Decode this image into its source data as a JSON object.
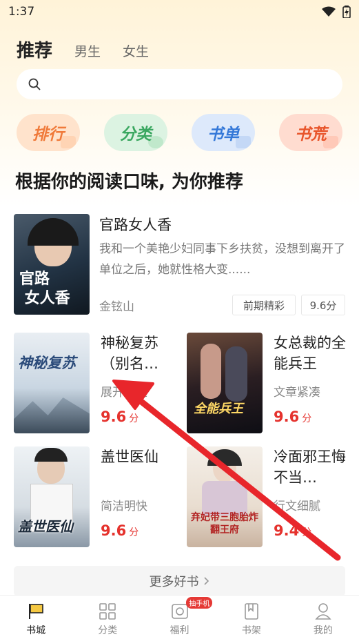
{
  "status": {
    "time": "1:37"
  },
  "header": {
    "tabs": [
      {
        "label": "推荐",
        "active": true
      },
      {
        "label": "男生",
        "active": false
      },
      {
        "label": "女生",
        "active": false
      }
    ]
  },
  "search": {
    "placeholder": ""
  },
  "quick_links": [
    {
      "label": "排行",
      "color": "#f07a3a",
      "bg": "#ffe3cc"
    },
    {
      "label": "分类",
      "color": "#3aa760",
      "bg": "#dcf3e2"
    },
    {
      "label": "书单",
      "color": "#3478d8",
      "bg": "#dde9fb"
    },
    {
      "label": "书荒",
      "color": "#e8542a",
      "bg": "#ffdcd0"
    }
  ],
  "section": {
    "title": "根据你的阅读口味, 为你推荐"
  },
  "featured": {
    "title": "官路女人香",
    "description": "我和一个美艳少妇同事下乡扶贫，没想到离开了单位之后，她就性格大变......",
    "author": "金铉山",
    "tag": "前期精彩",
    "score": "9.6分",
    "cover_text": "官路\n女人香"
  },
  "books": [
    {
      "title": "神秘复苏（别名…",
      "style": "展开迅速",
      "score": "9.6",
      "unit": "分",
      "cover_text": "神秘复苏"
    },
    {
      "title": "女总裁的全能兵王",
      "style": "文章紧凑",
      "score": "9.6",
      "unit": "分",
      "cover_text": "全能兵王"
    },
    {
      "title": "盖世医仙",
      "style": "简洁明快",
      "score": "9.6",
      "unit": "分",
      "cover_text": "盖世医仙"
    },
    {
      "title": "冷面邪王悔不当…",
      "style": "行文细腻",
      "score": "9.4",
      "unit": "分",
      "cover_text": "弃妃带三胞胎炸翻王府"
    }
  ],
  "more": {
    "label": "更多好书"
  },
  "bottom_nav": [
    {
      "label": "书城",
      "icon": "flag-icon",
      "active": true
    },
    {
      "label": "分类",
      "icon": "grid-icon",
      "active": false
    },
    {
      "label": "福利",
      "icon": "gift-icon",
      "active": false,
      "badge": "抽手机"
    },
    {
      "label": "书架",
      "icon": "bookshelf-icon",
      "active": false
    },
    {
      "label": "我的",
      "icon": "person-icon",
      "active": false
    }
  ]
}
